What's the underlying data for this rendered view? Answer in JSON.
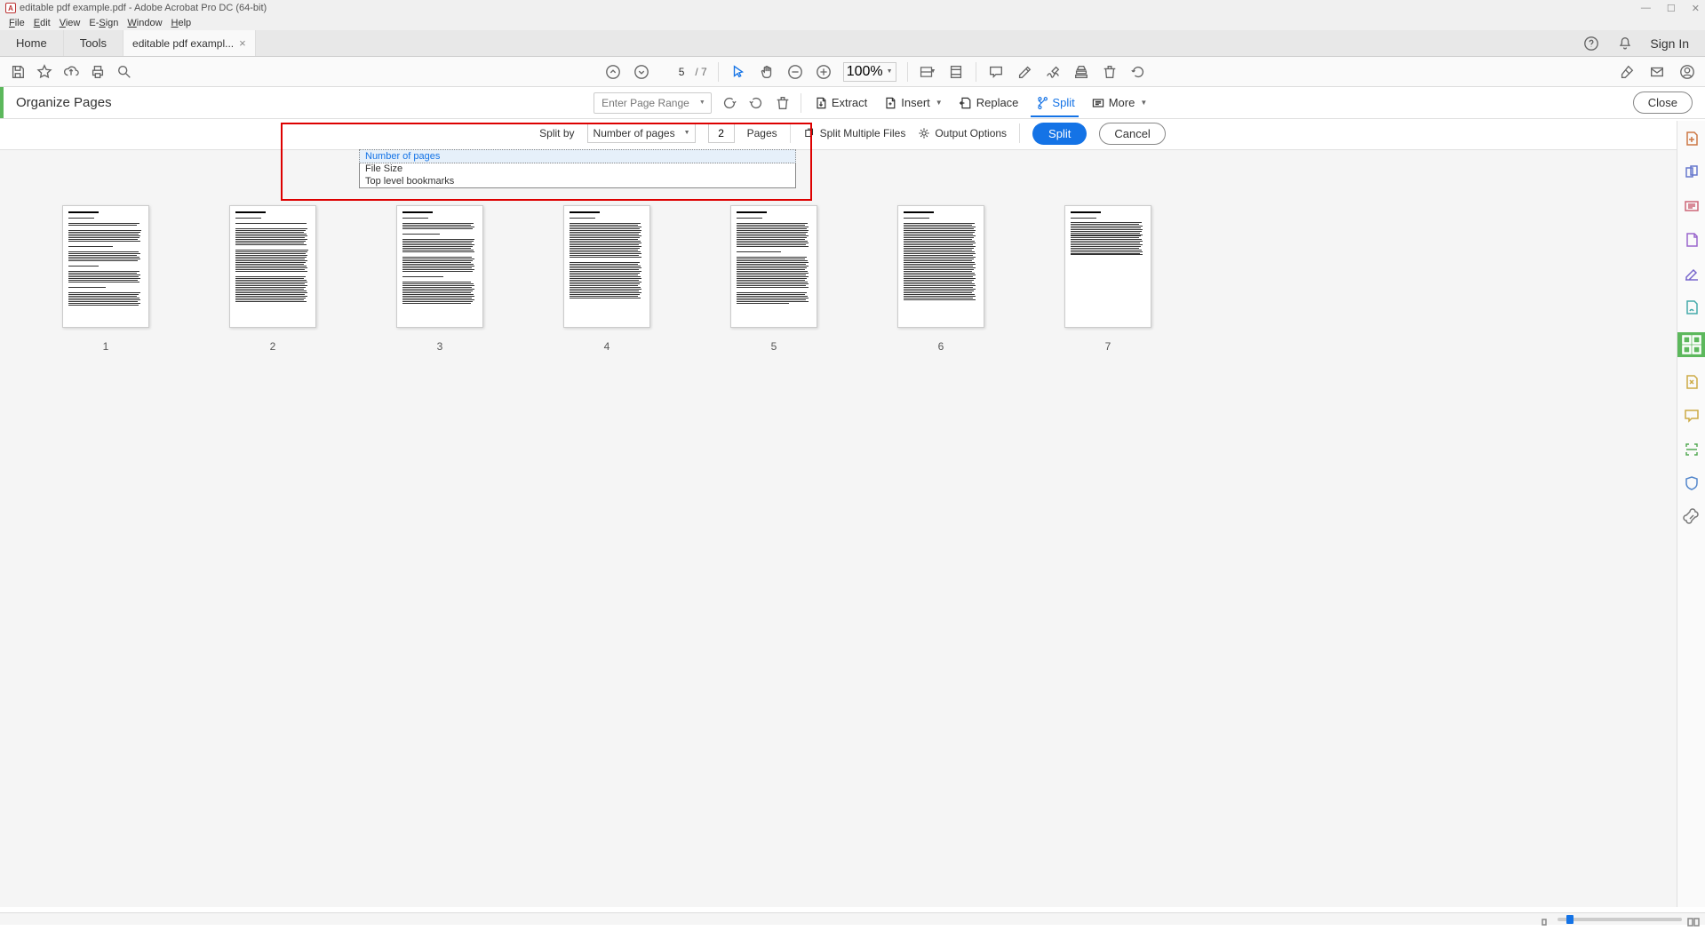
{
  "window": {
    "title": "editable pdf example.pdf - Adobe Acrobat Pro DC (64-bit)"
  },
  "menu": [
    "File",
    "Edit",
    "View",
    "E-Sign",
    "Window",
    "Help"
  ],
  "tabs": {
    "home": "Home",
    "tools": "Tools",
    "doc": "editable pdf exampl...",
    "signin": "Sign In"
  },
  "toolbar": {
    "page_current": "5",
    "page_total": "/ 7",
    "zoom": "100%"
  },
  "organize": {
    "title": "Organize Pages",
    "page_range_placeholder": "Enter Page Range",
    "extract": "Extract",
    "insert": "Insert",
    "replace": "Replace",
    "split": "Split",
    "more": "More",
    "close": "Close"
  },
  "split_bar": {
    "split_by_label": "Split by",
    "method": "Number of pages",
    "count": "2",
    "pages_label": "Pages",
    "multi": "Split Multiple Files",
    "output": "Output Options",
    "split_btn": "Split",
    "cancel_btn": "Cancel",
    "options": [
      "Number of pages",
      "File Size",
      "Top level bookmarks"
    ]
  },
  "thumbs": [
    "1",
    "2",
    "3",
    "4",
    "5",
    "6",
    "7"
  ]
}
